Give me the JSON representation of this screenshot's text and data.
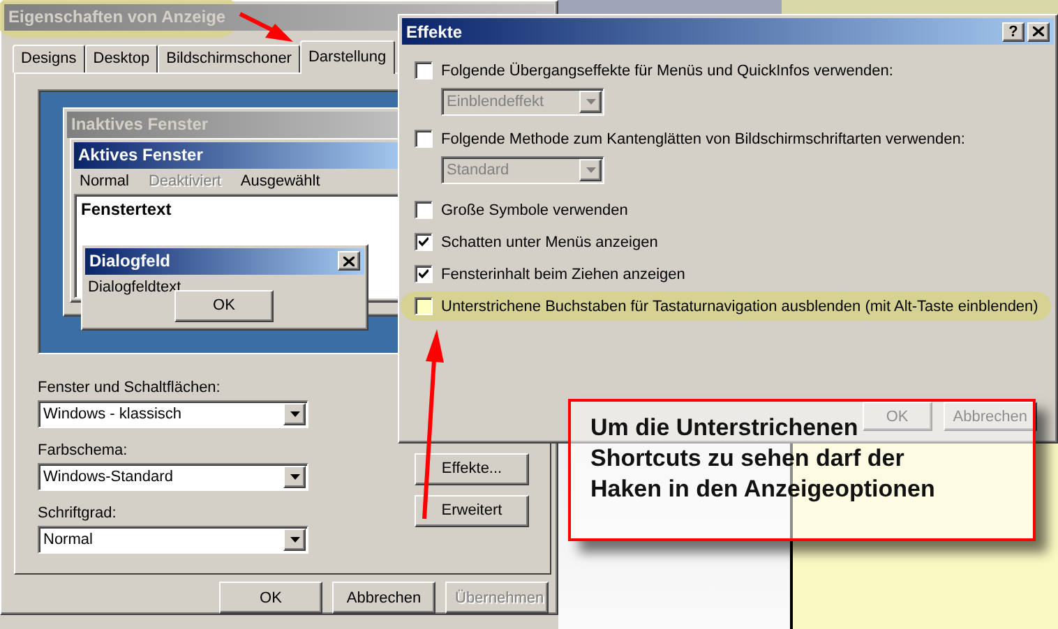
{
  "main_window": {
    "title": "Eigenschaften von Anzeige",
    "tabs": [
      {
        "label": "Designs",
        "selected": false
      },
      {
        "label": "Desktop",
        "selected": false
      },
      {
        "label": "Bildschirmschoner",
        "selected": false
      },
      {
        "label": "Darstellung",
        "selected": true
      }
    ],
    "preview": {
      "inactive_title": "Inaktives Fenster",
      "active_title": "Aktives Fenster",
      "menu": [
        {
          "label": "Normal",
          "disabled": false
        },
        {
          "label": "Deaktiviert",
          "disabled": true
        },
        {
          "label": "Ausgewählt",
          "disabled": false
        }
      ],
      "window_text": "Fenstertext",
      "dialog_title": "Dialogfeld",
      "dialog_text": "Dialogfeldtext",
      "dialog_button": "OK"
    },
    "fields": [
      {
        "label": "Fenster und Schaltflächen:",
        "value": "Windows - klassisch"
      },
      {
        "label": "Farbschema:",
        "value": "Windows-Standard"
      },
      {
        "label": "Schriftgrad:",
        "value": "Normal"
      }
    ],
    "side_buttons": [
      "Effekte...",
      "Erweitert"
    ],
    "footer_buttons": [
      {
        "label": "OK",
        "disabled": false
      },
      {
        "label": "Abbrechen",
        "disabled": false
      },
      {
        "label": "Übernehmen",
        "disabled": true
      }
    ]
  },
  "effects_dialog": {
    "title": "Effekte",
    "help": "?",
    "options": [
      {
        "kind": "checkbox",
        "label": "Folgende Übergangseffekte für Menüs und QuickInfos verwenden:",
        "checked": false,
        "highlighted": false
      },
      {
        "kind": "select",
        "value": "Einblendeffekt",
        "disabled": true
      },
      {
        "kind": "checkbox",
        "label": "Folgende Methode zum Kantenglätten von Bildschirmschriftarten verwenden:",
        "checked": false,
        "highlighted": false
      },
      {
        "kind": "select",
        "value": "Standard",
        "disabled": true
      },
      {
        "kind": "checkbox",
        "label": "Große Symbole verwenden",
        "checked": false,
        "highlighted": false
      },
      {
        "kind": "checkbox",
        "label": "Schatten unter Menüs anzeigen",
        "checked": true,
        "highlighted": false
      },
      {
        "kind": "checkbox",
        "label": "Fensterinhalt beim Ziehen anzeigen",
        "checked": true,
        "highlighted": false
      },
      {
        "kind": "checkbox",
        "label": "Unterstrichene Buchstaben für Tastaturnavigation ausblenden (mit Alt-Taste einblenden)",
        "checked": false,
        "highlighted": true
      }
    ],
    "buttons": [
      "OK",
      "Abbrechen"
    ]
  },
  "callout": {
    "lines": [
      "Um die Unterstrichenen",
      "Shortcuts zu sehen darf der",
      "Haken in den Anzeigeoptionen"
    ]
  }
}
